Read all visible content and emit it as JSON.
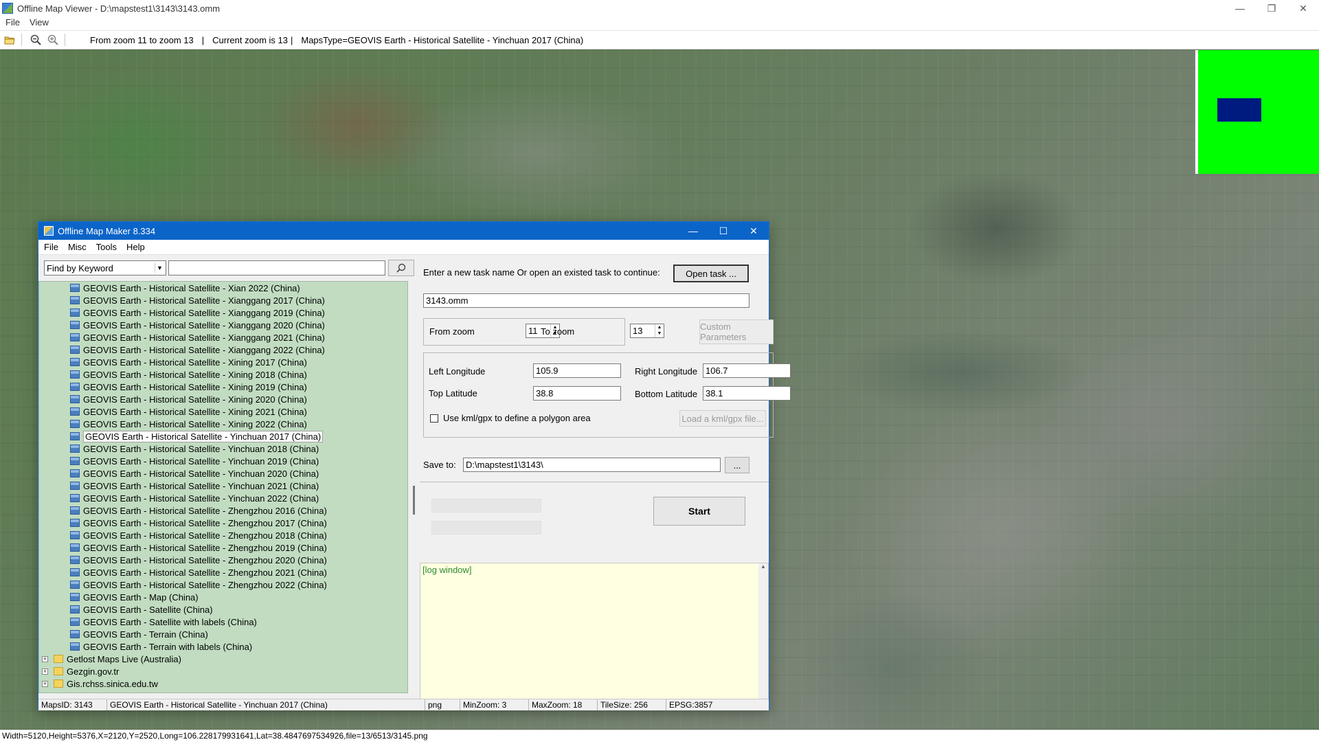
{
  "viewer": {
    "title": "Offline Map Viewer - D:\\mapstest1\\3143\\3143.omm",
    "menu": [
      "File",
      "View"
    ],
    "window_controls": [
      "—",
      "❐",
      "✕"
    ],
    "toolbar_info": {
      "zoom_range": "From zoom 11 to zoom 13",
      "separator": "|",
      "current_zoom": "Current zoom is 13",
      "maps_type": "MapsType=GEOVIS Earth - Historical Satellite - Yinchuan 2017 (China)"
    },
    "status": "Width=5120,Height=5376,X=2120,Y=2520,Long=106.228179931641,Lat=38.4847697534926,file=13/6513/3145.png",
    "minimap": {
      "background": "#00ff00",
      "viewport_color": "#001b7f"
    }
  },
  "dialog": {
    "title": "Offline Map Maker 8.334",
    "window_controls": [
      "—",
      "☐",
      "✕"
    ],
    "menu": [
      "File",
      "Misc",
      "Tools",
      "Help"
    ],
    "find": {
      "mode": "Find by Keyword",
      "query": ""
    },
    "tree": {
      "children": [
        "GEOVIS Earth - Historical Satellite - Xian 2022 (China)",
        "GEOVIS Earth - Historical Satellite - Xianggang 2017 (China)",
        "GEOVIS Earth - Historical Satellite - Xianggang 2019 (China)",
        "GEOVIS Earth - Historical Satellite - Xianggang 2020 (China)",
        "GEOVIS Earth - Historical Satellite - Xianggang 2021 (China)",
        "GEOVIS Earth - Historical Satellite - Xianggang 2022 (China)",
        "GEOVIS Earth - Historical Satellite - Xining 2017 (China)",
        "GEOVIS Earth - Historical Satellite - Xining 2018 (China)",
        "GEOVIS Earth - Historical Satellite - Xining 2019 (China)",
        "GEOVIS Earth - Historical Satellite - Xining 2020 (China)",
        "GEOVIS Earth - Historical Satellite - Xining 2021 (China)",
        "GEOVIS Earth - Historical Satellite - Xining 2022 (China)",
        "GEOVIS Earth - Historical Satellite - Yinchuan 2017 (China)",
        "GEOVIS Earth - Historical Satellite - Yinchuan 2018 (China)",
        "GEOVIS Earth - Historical Satellite - Yinchuan 2019 (China)",
        "GEOVIS Earth - Historical Satellite - Yinchuan 2020 (China)",
        "GEOVIS Earth - Historical Satellite - Yinchuan 2021 (China)",
        "GEOVIS Earth - Historical Satellite - Yinchuan 2022 (China)",
        "GEOVIS Earth - Historical Satellite - Zhengzhou 2016 (China)",
        "GEOVIS Earth - Historical Satellite - Zhengzhou 2017 (China)",
        "GEOVIS Earth - Historical Satellite - Zhengzhou 2018 (China)",
        "GEOVIS Earth - Historical Satellite - Zhengzhou 2019 (China)",
        "GEOVIS Earth - Historical Satellite - Zhengzhou 2020 (China)",
        "GEOVIS Earth - Historical Satellite - Zhengzhou 2021 (China)",
        "GEOVIS Earth - Historical Satellite - Zhengzhou 2022 (China)",
        "GEOVIS Earth - Map (China)",
        "GEOVIS Earth - Satellite (China)",
        "GEOVIS Earth - Satellite with labels (China)",
        "GEOVIS Earth - Terrain (China)",
        "GEOVIS Earth - Terrain with labels (China)"
      ],
      "selected": "GEOVIS Earth - Historical Satellite - Yinchuan 2017 (China)",
      "folders": [
        "Getlost Maps Live (Australia)",
        "Gezgin.gov.tr",
        "Gis.rchss.sinica.edu.tw"
      ]
    },
    "task": {
      "prompt": "Enter a new task name Or open an existed task to continue:",
      "open_button": "Open task ...",
      "name": "3143.omm"
    },
    "zoom": {
      "from_label": "From zoom",
      "from_value": "11",
      "to_label": "To zoom",
      "to_value": "13",
      "custom_button": "Custom Parameters"
    },
    "area": {
      "left_lon_label": "Left Longitude",
      "left_lon": "105.9",
      "right_lon_label": "Right Longitude",
      "right_lon": "106.7",
      "top_lat_label": "Top Latitude",
      "top_lat": "38.8",
      "bottom_lat_label": "Bottom Latitude",
      "bottom_lat": "38.1",
      "kml_checkbox_label": "Use kml/gpx to define a polygon area",
      "kml_button": "Load a kml/gpx file..."
    },
    "save": {
      "label": "Save to:",
      "path": "D:\\mapstest1\\3143\\",
      "browse_button": "..."
    },
    "start_button": "Start",
    "log_text": "[log window]",
    "status": {
      "maps_id": "MapsID: 3143",
      "maps_name": "GEOVIS Earth - Historical Satellite - Yinchuan 2017 (China)",
      "format": "png",
      "min_zoom": "MinZoom: 3",
      "max_zoom": "MaxZoom: 18",
      "tile_size": "TileSize: 256",
      "epsg": "EPSG:3857"
    }
  }
}
